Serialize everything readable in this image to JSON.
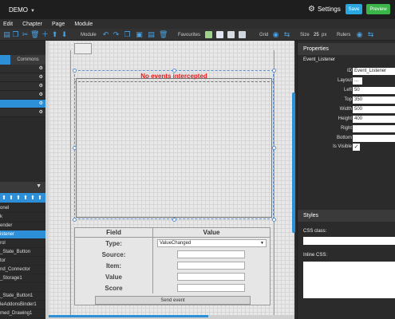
{
  "topbar": {
    "app_title": "DEMO",
    "settings_label": "Settings",
    "save_label": "Save",
    "preview_label": "Preview"
  },
  "menu": [
    "Edit",
    "Chapter",
    "Page",
    "Module"
  ],
  "toolbar": {
    "module_label": "Module",
    "favourites_label": "Favourites",
    "grid_label": "Grid",
    "size_label": "Size",
    "size_value": "25",
    "size_unit": "px",
    "rulers_label": "Rulers"
  },
  "left_panel": {
    "tab_commons": "Commons",
    "objects": [
      "onel",
      "k",
      "ender",
      "istener",
      "rol",
      "_State_Button",
      "tor",
      "nd_Connector",
      "_Storage1",
      "",
      "_State_Button1",
      "leAddonsBinder1",
      "med_Drawing1"
    ]
  },
  "canvas": {
    "no_events_text": "No events intercepted",
    "table_header_field": "Field",
    "table_header_value": "Value",
    "rows": [
      {
        "field": "Type:",
        "select_value": "ValueChanged"
      },
      {
        "field": "Source:"
      },
      {
        "field": "Item:"
      },
      {
        "field": "Value"
      },
      {
        "field": "Score"
      }
    ],
    "send_button": "Send event"
  },
  "properties": {
    "header": "Properties",
    "object_name": "Event_Listener",
    "fields": [
      {
        "label": "ID",
        "value": "Event_Listener"
      },
      {
        "label": "Layout",
        "value": "..."
      },
      {
        "label": "Left",
        "value": "50"
      },
      {
        "label": "Top",
        "value": "350"
      },
      {
        "label": "Width",
        "value": "500"
      },
      {
        "label": "Height",
        "value": "400"
      },
      {
        "label": "Right",
        "value": ""
      },
      {
        "label": "Bottom",
        "value": ""
      }
    ],
    "is_visible_label": "Is Visible",
    "is_visible": true
  },
  "styles": {
    "header": "Styles",
    "css_class_label": "CSS class:",
    "inline_css_label": "Inline CSS:"
  },
  "colors": {
    "accent": "#2c8fd8",
    "save": "#2aa7e0",
    "preview": "#3bb54a",
    "alert": "#e81c1c"
  }
}
